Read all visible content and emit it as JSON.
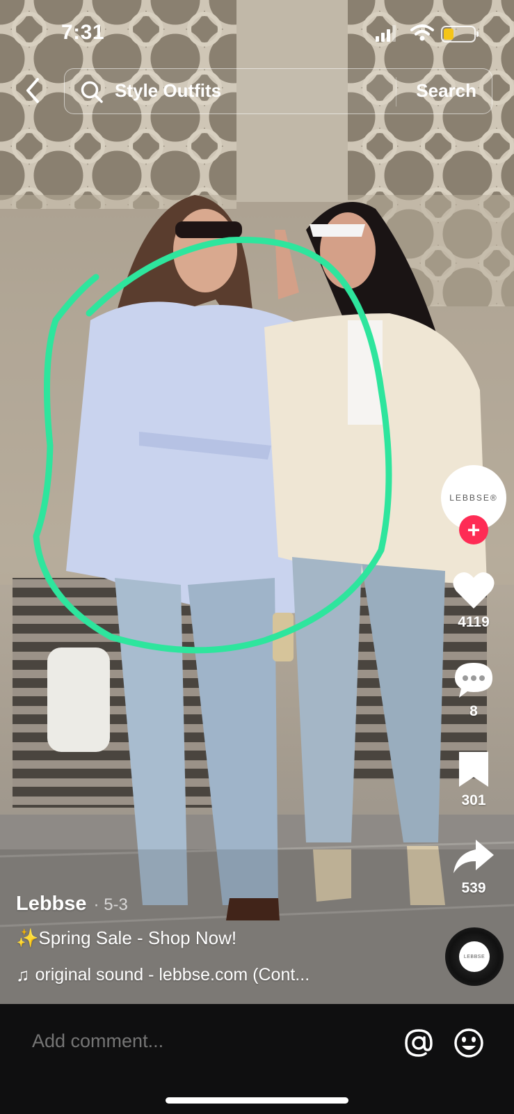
{
  "status_bar": {
    "time": "7:31",
    "battery_level": 0.3,
    "battery_color": "#f5c518"
  },
  "search": {
    "query": "Style Outfits",
    "button_label": "Search"
  },
  "creator": {
    "avatar_text": "LEBBSE®"
  },
  "actions": {
    "likes": "4119",
    "comments": "8",
    "saves": "301",
    "shares": "539"
  },
  "caption": {
    "author": "Lebbse",
    "date": "· 5-3",
    "description": "✨Spring Sale - Shop Now!",
    "sound_note": "♫",
    "sound": "original sound - lebbse.com (Cont..."
  },
  "disc": {
    "label": "LEBBSE"
  },
  "bottom_bar": {
    "comment_placeholder": "Add comment..."
  },
  "colors": {
    "highlight_stroke": "#2ee59d",
    "follow_button": "#fe2c55",
    "bottom_bar": "#0f0f10"
  },
  "icons": [
    "back-icon",
    "search-icon",
    "heart-icon",
    "comment-icon",
    "bookmark-icon",
    "share-icon",
    "music-note-icon",
    "at-icon",
    "emoji-icon"
  ]
}
